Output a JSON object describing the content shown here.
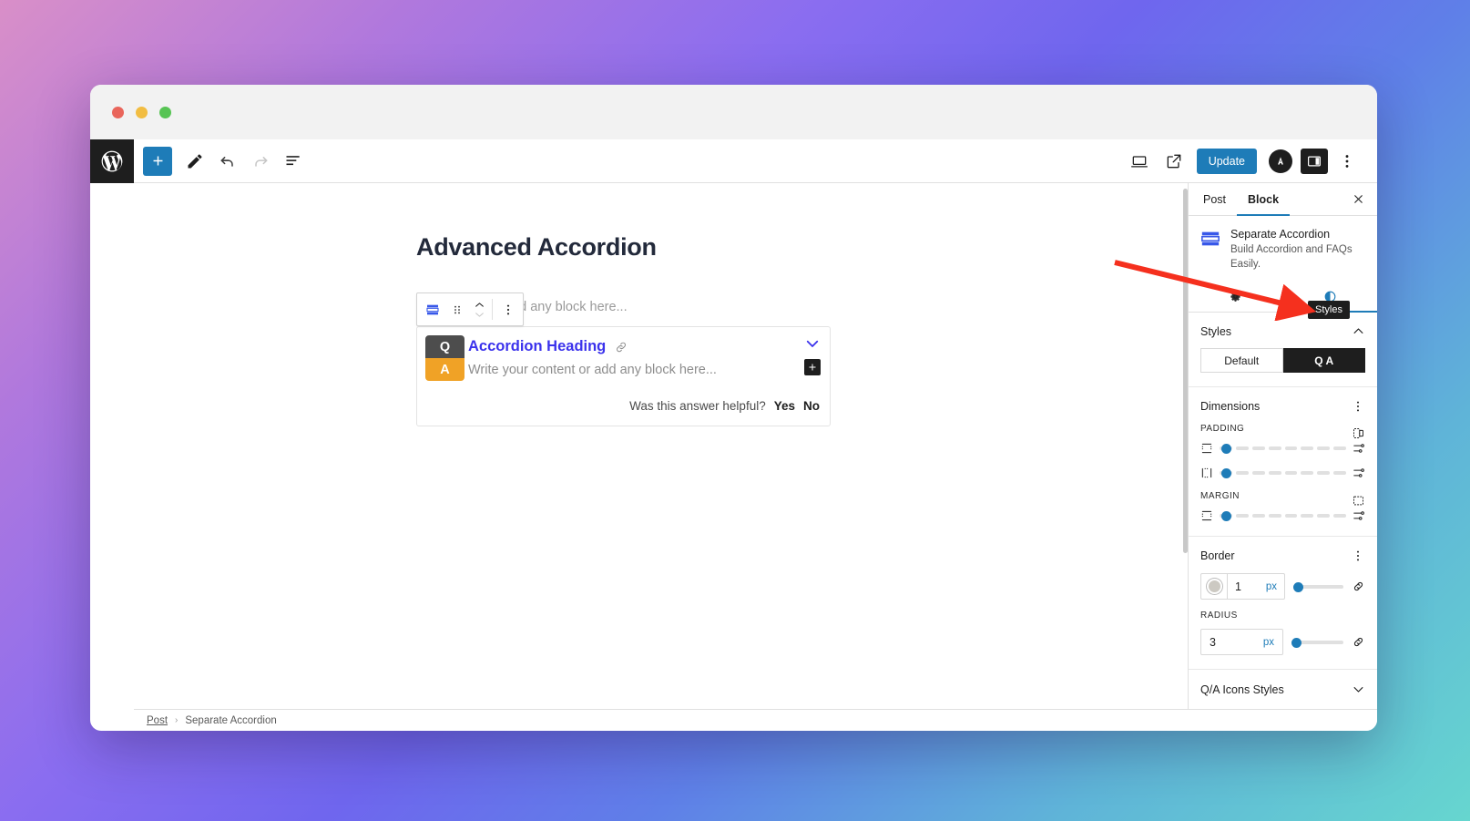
{
  "window": {
    "traffic_lights": [
      "close",
      "minimize",
      "maximize"
    ]
  },
  "topbar": {
    "logo": "wordpress-logo",
    "left_tools": [
      {
        "name": "add-block-button",
        "label": "+"
      },
      {
        "name": "edit-tool-button",
        "label": "pencil-icon"
      },
      {
        "name": "undo-button",
        "label": "undo-icon"
      },
      {
        "name": "redo-button",
        "label": "redo-icon"
      },
      {
        "name": "list-view-button",
        "label": "list-view-icon"
      }
    ],
    "right_tools": [
      {
        "name": "view-device-button",
        "label": "desktop-icon"
      },
      {
        "name": "preview-button",
        "label": "external-link-icon"
      }
    ],
    "update_label": "Update",
    "avatar_label": "A",
    "settings_toggle": "settings-sidebar-icon",
    "options_menu": "three-dots-icon"
  },
  "canvas": {
    "post_title": "Advanced Accordion",
    "paragraph_placeholder": "add any block here...",
    "block_toolbar": {
      "block_type_icon": "separate-accordion-icon",
      "drag_icon": "drag-handle-icon",
      "move_up_icon": "chevron-up-icon",
      "move_down_icon": "chevron-down-icon",
      "options_icon": "vertical-dots-icon"
    },
    "accordion": {
      "q_badge": "Q",
      "a_badge": "A",
      "heading": "Accordion Heading",
      "link_icon": "link-icon",
      "content_placeholder": "Write your content or add any block here...",
      "toggle_icon": "chevron-down-icon",
      "add_block_icon": "plus-icon",
      "helpful_text": "Was this answer helpful?",
      "yes_label": "Yes",
      "no_label": "No"
    }
  },
  "breadcrumb": {
    "items": [
      "Post",
      "Separate Accordion"
    ],
    "separator": "›"
  },
  "settings": {
    "tabs": [
      {
        "label": "Post",
        "active": false
      },
      {
        "label": "Block",
        "active": true
      }
    ],
    "close_icon": "close-icon",
    "block": {
      "title": "Separate Accordion",
      "description": "Build Accordion and FAQs Easily.",
      "icon": "separate-accordion-icon"
    },
    "icon_tabs": [
      {
        "name": "settings-tab",
        "icon": "gear-icon",
        "active": false
      },
      {
        "name": "styles-tab",
        "icon": "half-circle-icon",
        "active": true
      }
    ],
    "tooltip": "Styles",
    "styles": {
      "title": "Styles",
      "chevron": "chevron-up-icon",
      "options": [
        {
          "label": "Default",
          "active": false
        },
        {
          "label": "Q A",
          "active": true
        }
      ]
    },
    "dimensions": {
      "title": "Dimensions",
      "options_icon": "vertical-dots-icon",
      "padding": {
        "label": "PADDING",
        "link_icon": "sides-link-icon",
        "sliders": [
          {
            "name": "padding-vertical-slider",
            "icon": "padding-vertical-icon",
            "value": 3,
            "end_icon": "settings-sliders-icon"
          },
          {
            "name": "padding-horizontal-slider",
            "icon": "padding-horizontal-icon",
            "value": 3,
            "end_icon": "settings-sliders-icon"
          }
        ]
      },
      "margin": {
        "label": "MARGIN",
        "link_icon": "sides-link-icon",
        "sliders": [
          {
            "name": "margin-slider",
            "icon": "margin-icon",
            "value": 3,
            "end_icon": "settings-sliders-icon"
          }
        ]
      }
    },
    "border": {
      "title": "Border",
      "options_icon": "vertical-dots-icon",
      "color_swatch": "#ccc9c2",
      "width_value": "1",
      "width_unit": "px",
      "width_slider_value": 5,
      "link_icon": "link-sides-icon",
      "radius_label": "RADIUS",
      "radius_value": "3",
      "radius_unit": "px",
      "radius_slider_value": 5
    },
    "collapsed_sections": [
      {
        "label": "Q/A Icons Styles",
        "chevron": "chevron-down-icon"
      }
    ]
  },
  "colors": {
    "accent_blue": "#1e7cb8",
    "heading_blue": "#3b32ec",
    "q_badge": "#4d4d4d",
    "a_badge": "#f0a226",
    "dark": "#1e1e1e",
    "annotation_red": "#f5301e"
  }
}
